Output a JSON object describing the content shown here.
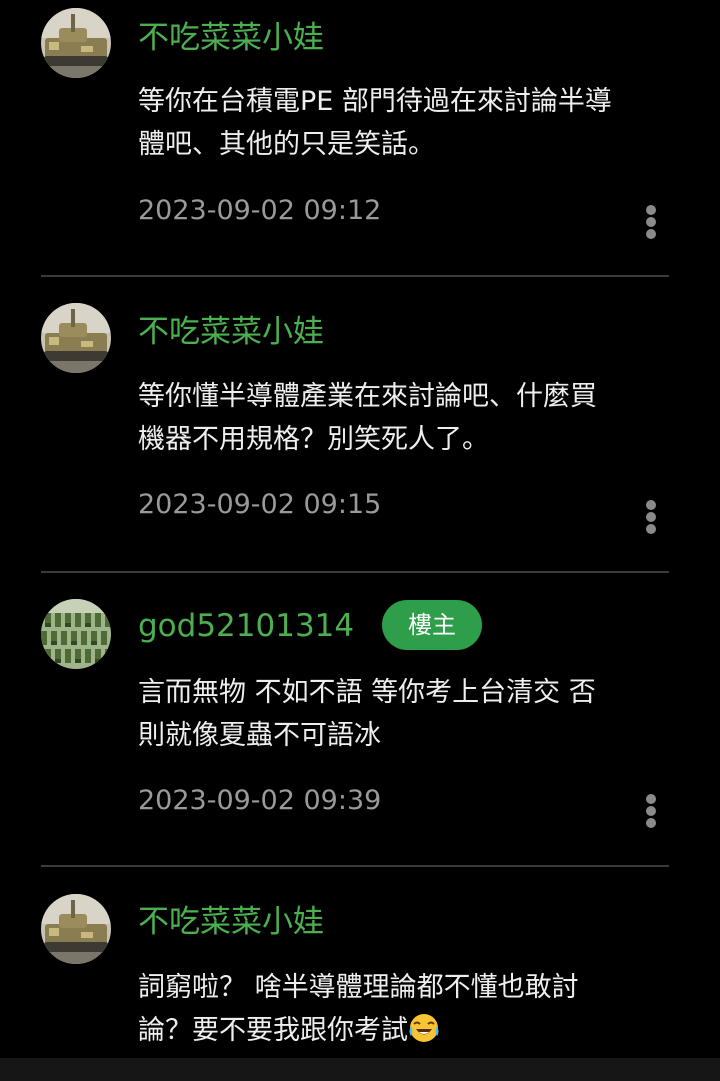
{
  "comments": [
    {
      "username": "不吃菜菜小娃",
      "avatar": "tank-avatar",
      "lines": [
        "等你在台積電PE 部門待過在來討論半導",
        "體吧、其他的只是笑話。"
      ],
      "timestamp": "2023-09-02 09:12"
    },
    {
      "username": "不吃菜菜小娃",
      "avatar": "tank-avatar",
      "lines": [
        "等你懂半導體產業在來討論吧、什麼買",
        "機器不用規格？別笑死人了。"
      ],
      "timestamp": "2023-09-02 09:15"
    },
    {
      "username": "god52101314",
      "avatar": "soldiers-avatar",
      "badge": "樓主",
      "lines": [
        "言而無物 不如不語 等你考上台清交 否",
        "則就像夏蟲不可語冰"
      ],
      "timestamp": "2023-09-02 09:39"
    },
    {
      "username": "不吃菜菜小娃",
      "avatar": "tank-avatar",
      "lines": [
        "詞窮啦？ 啥半導體理論都不懂也敢討",
        "論？要不要我跟你考試"
      ],
      "emoji": "face-with-tears-of-joy",
      "timestamp": ""
    }
  ],
  "colors": {
    "background": "#000000",
    "username": "#4caf50",
    "badge_bg": "#2e9e4a",
    "text": "#eeeeee",
    "timestamp": "#9a9a9a",
    "divider": "#3a3a3a"
  }
}
